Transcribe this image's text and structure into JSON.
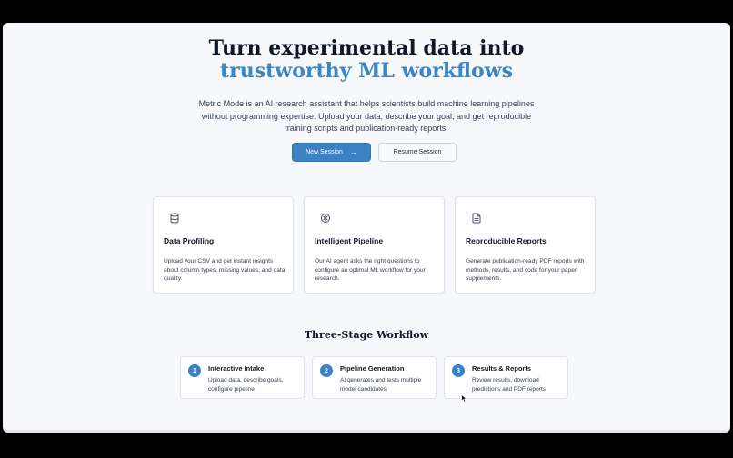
{
  "hero": {
    "title_line1": "Turn experimental data into",
    "title_line2": "trustworthy ML workflows",
    "subtitle": "Metric Mode is an AI research assistant that helps scientists build machine learning pipelines without programming expertise. Upload your data, describe your goal, and get reproducible training scripts and publication-ready reports.",
    "accent_color": "#3d86c6"
  },
  "actions": {
    "new_session_label": "New Session",
    "new_session_icon": "arrow-right-icon",
    "resume_session_label": "Resume Session"
  },
  "features": [
    {
      "icon": "database-icon",
      "title": "Data Profiling",
      "description": "Upload your CSV and get instant insights about column types, missing values, and data quality."
    },
    {
      "icon": "brain-icon",
      "title": "Intelligent Pipeline",
      "description": "Our AI agent asks the right questions to configure an optimal ML workflow for your research."
    },
    {
      "icon": "document-icon",
      "title": "Reproducible Reports",
      "description": "Generate publication-ready PDF reports with methods, results, and code for your paper supplements."
    }
  ],
  "workflow": {
    "title": "Three-Stage Workflow",
    "steps": [
      {
        "number": "1",
        "title": "Interactive Intake",
        "description": "Upload data, describe goals, configure pipeline"
      },
      {
        "number": "2",
        "title": "Pipeline Generation",
        "description": "AI generates and tests multiple model candidates"
      },
      {
        "number": "3",
        "title": "Results & Reports",
        "description": "Review results, download predictions and PDF reports"
      }
    ]
  }
}
